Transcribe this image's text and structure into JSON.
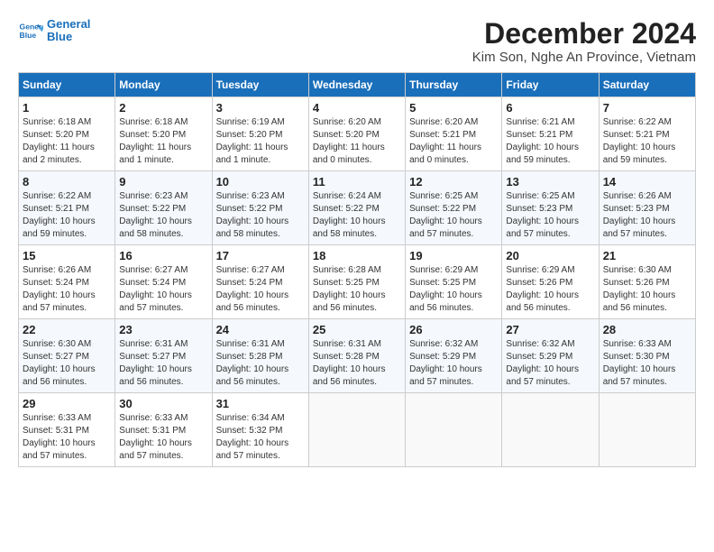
{
  "header": {
    "logo_line1": "General",
    "logo_line2": "Blue",
    "month_title": "December 2024",
    "location": "Kim Son, Nghe An Province, Vietnam"
  },
  "weekdays": [
    "Sunday",
    "Monday",
    "Tuesday",
    "Wednesday",
    "Thursday",
    "Friday",
    "Saturday"
  ],
  "weeks": [
    [
      {
        "day": "1",
        "sunrise": "6:18 AM",
        "sunset": "5:20 PM",
        "daylight": "11 hours and 2 minutes."
      },
      {
        "day": "2",
        "sunrise": "6:18 AM",
        "sunset": "5:20 PM",
        "daylight": "11 hours and 1 minute."
      },
      {
        "day": "3",
        "sunrise": "6:19 AM",
        "sunset": "5:20 PM",
        "daylight": "11 hours and 1 minute."
      },
      {
        "day": "4",
        "sunrise": "6:20 AM",
        "sunset": "5:20 PM",
        "daylight": "11 hours and 0 minutes."
      },
      {
        "day": "5",
        "sunrise": "6:20 AM",
        "sunset": "5:21 PM",
        "daylight": "11 hours and 0 minutes."
      },
      {
        "day": "6",
        "sunrise": "6:21 AM",
        "sunset": "5:21 PM",
        "daylight": "10 hours and 59 minutes."
      },
      {
        "day": "7",
        "sunrise": "6:22 AM",
        "sunset": "5:21 PM",
        "daylight": "10 hours and 59 minutes."
      }
    ],
    [
      {
        "day": "8",
        "sunrise": "6:22 AM",
        "sunset": "5:21 PM",
        "daylight": "10 hours and 59 minutes."
      },
      {
        "day": "9",
        "sunrise": "6:23 AM",
        "sunset": "5:22 PM",
        "daylight": "10 hours and 58 minutes."
      },
      {
        "day": "10",
        "sunrise": "6:23 AM",
        "sunset": "5:22 PM",
        "daylight": "10 hours and 58 minutes."
      },
      {
        "day": "11",
        "sunrise": "6:24 AM",
        "sunset": "5:22 PM",
        "daylight": "10 hours and 58 minutes."
      },
      {
        "day": "12",
        "sunrise": "6:25 AM",
        "sunset": "5:22 PM",
        "daylight": "10 hours and 57 minutes."
      },
      {
        "day": "13",
        "sunrise": "6:25 AM",
        "sunset": "5:23 PM",
        "daylight": "10 hours and 57 minutes."
      },
      {
        "day": "14",
        "sunrise": "6:26 AM",
        "sunset": "5:23 PM",
        "daylight": "10 hours and 57 minutes."
      }
    ],
    [
      {
        "day": "15",
        "sunrise": "6:26 AM",
        "sunset": "5:24 PM",
        "daylight": "10 hours and 57 minutes."
      },
      {
        "day": "16",
        "sunrise": "6:27 AM",
        "sunset": "5:24 PM",
        "daylight": "10 hours and 57 minutes."
      },
      {
        "day": "17",
        "sunrise": "6:27 AM",
        "sunset": "5:24 PM",
        "daylight": "10 hours and 56 minutes."
      },
      {
        "day": "18",
        "sunrise": "6:28 AM",
        "sunset": "5:25 PM",
        "daylight": "10 hours and 56 minutes."
      },
      {
        "day": "19",
        "sunrise": "6:29 AM",
        "sunset": "5:25 PM",
        "daylight": "10 hours and 56 minutes."
      },
      {
        "day": "20",
        "sunrise": "6:29 AM",
        "sunset": "5:26 PM",
        "daylight": "10 hours and 56 minutes."
      },
      {
        "day": "21",
        "sunrise": "6:30 AM",
        "sunset": "5:26 PM",
        "daylight": "10 hours and 56 minutes."
      }
    ],
    [
      {
        "day": "22",
        "sunrise": "6:30 AM",
        "sunset": "5:27 PM",
        "daylight": "10 hours and 56 minutes."
      },
      {
        "day": "23",
        "sunrise": "6:31 AM",
        "sunset": "5:27 PM",
        "daylight": "10 hours and 56 minutes."
      },
      {
        "day": "24",
        "sunrise": "6:31 AM",
        "sunset": "5:28 PM",
        "daylight": "10 hours and 56 minutes."
      },
      {
        "day": "25",
        "sunrise": "6:31 AM",
        "sunset": "5:28 PM",
        "daylight": "10 hours and 56 minutes."
      },
      {
        "day": "26",
        "sunrise": "6:32 AM",
        "sunset": "5:29 PM",
        "daylight": "10 hours and 57 minutes."
      },
      {
        "day": "27",
        "sunrise": "6:32 AM",
        "sunset": "5:29 PM",
        "daylight": "10 hours and 57 minutes."
      },
      {
        "day": "28",
        "sunrise": "6:33 AM",
        "sunset": "5:30 PM",
        "daylight": "10 hours and 57 minutes."
      }
    ],
    [
      {
        "day": "29",
        "sunrise": "6:33 AM",
        "sunset": "5:31 PM",
        "daylight": "10 hours and 57 minutes."
      },
      {
        "day": "30",
        "sunrise": "6:33 AM",
        "sunset": "5:31 PM",
        "daylight": "10 hours and 57 minutes."
      },
      {
        "day": "31",
        "sunrise": "6:34 AM",
        "sunset": "5:32 PM",
        "daylight": "10 hours and 57 minutes."
      },
      null,
      null,
      null,
      null
    ]
  ],
  "labels": {
    "sunrise": "Sunrise:",
    "sunset": "Sunset:",
    "daylight": "Daylight:"
  }
}
